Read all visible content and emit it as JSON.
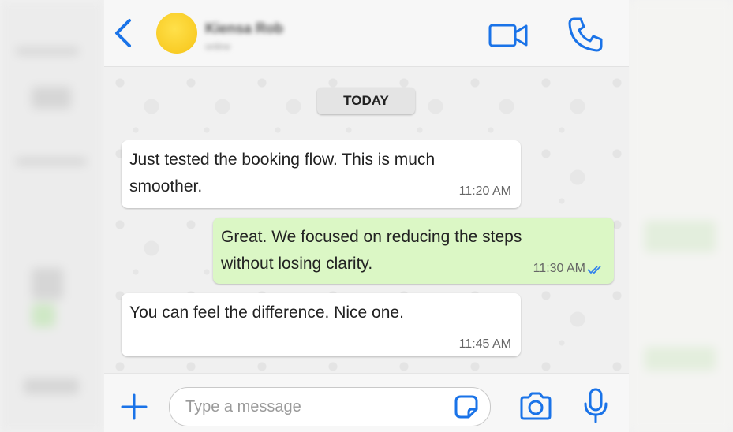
{
  "header": {
    "contact_name": "Kiensa Rob",
    "contact_status": "online"
  },
  "chat": {
    "date_label": "TODAY",
    "messages": [
      {
        "direction": "incoming",
        "line1": "Just tested the booking flow. This is much",
        "line2": "smoother.",
        "time": "11:20 AM"
      },
      {
        "direction": "outgoing",
        "line1": "Great. We focused on reducing the steps",
        "line2": "without losing clarity.",
        "time": "11:30 AM",
        "read": true
      },
      {
        "direction": "incoming",
        "line1": "You can feel the difference. Nice one.",
        "time": "11:45 AM"
      }
    ]
  },
  "composer": {
    "placeholder": "Type a message",
    "value": ""
  },
  "icons": {
    "back": "chevron-left-icon",
    "video": "video-camera-icon",
    "call": "phone-icon",
    "add": "plus-icon",
    "sticker": "sticker-icon",
    "camera": "camera-icon",
    "mic": "microphone-icon",
    "read_receipt": "double-check-icon"
  },
  "colors": {
    "accent": "#1a73e8",
    "outgoing_bubble": "#dbf7c5",
    "incoming_bubble": "#ffffff",
    "avatar": "#f6c417"
  }
}
